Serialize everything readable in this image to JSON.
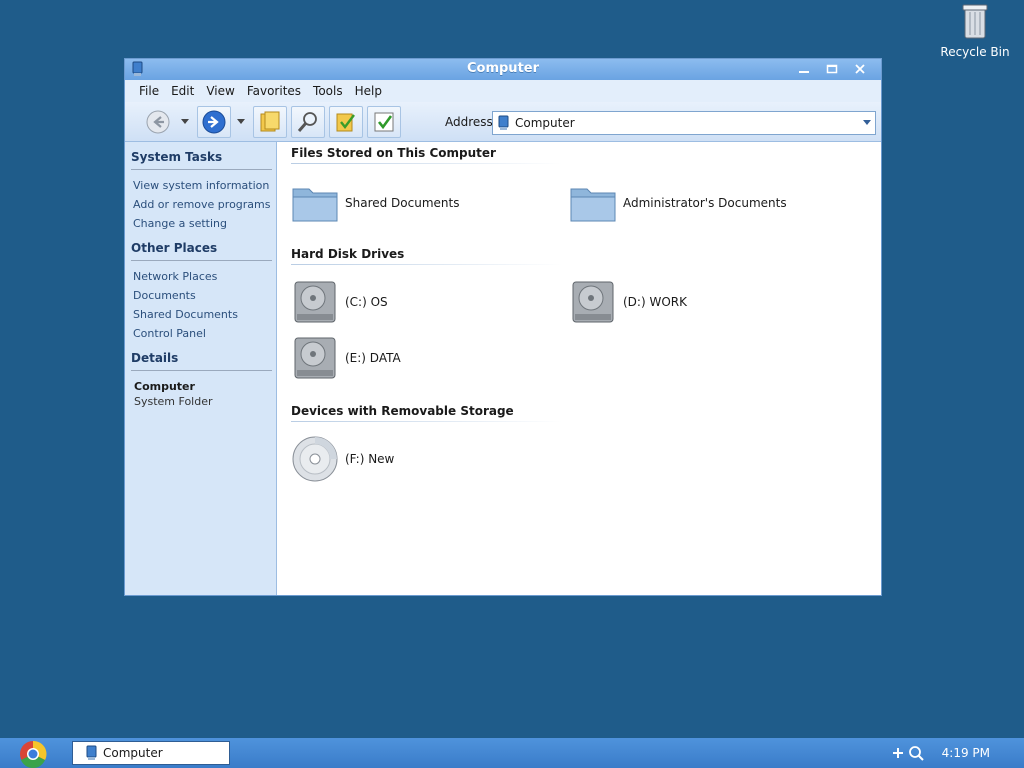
{
  "desktop": {
    "recycle_bin_label": "Recycle Bin"
  },
  "window": {
    "title": "Computer",
    "menu": [
      "File",
      "Edit",
      "View",
      "Favorites",
      "Tools",
      "Help"
    ],
    "address_label": "Address",
    "address_value": "Computer"
  },
  "taskpane": {
    "system_tasks": {
      "title": "System Tasks",
      "links": [
        "View system information",
        "Add or remove programs",
        "Change a setting"
      ]
    },
    "other_places": {
      "title": "Other Places",
      "links": [
        "Network Places",
        "Documents",
        "Shared Documents",
        "Control Panel"
      ]
    },
    "details": {
      "title": "Details",
      "name": "Computer",
      "type": "System Folder"
    }
  },
  "content": {
    "files_group": {
      "title": "Files Stored on This Computer",
      "items": [
        "Shared Documents",
        "Administrator's Documents"
      ]
    },
    "hdd_group": {
      "title": "Hard Disk Drives",
      "items": [
        "(C:) OS",
        "(D:) WORK",
        "(E:) DATA"
      ]
    },
    "removable_group": {
      "title": "Devices with Removable Storage",
      "items": [
        "(F:) New"
      ]
    }
  },
  "taskbar": {
    "task_label": "Computer",
    "clock": "4:19 PM"
  },
  "colors": {
    "desktop": "#1f5c8a",
    "title_bar": "#6aa3e2",
    "task_pane": "#d6e6f8",
    "taskbar": "#3a7cc9"
  }
}
